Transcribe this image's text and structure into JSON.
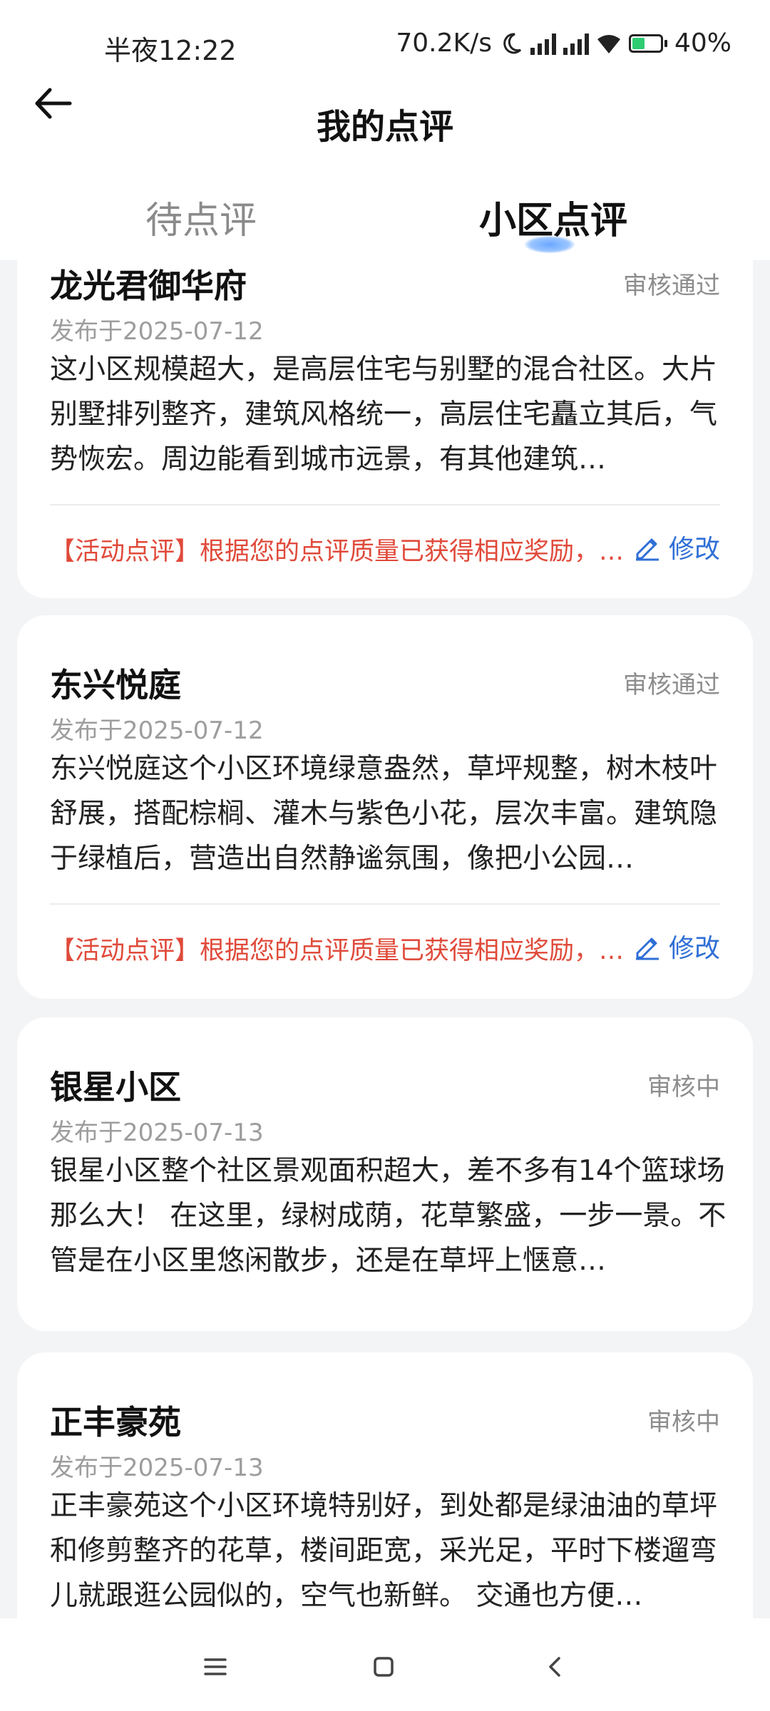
{
  "status_bar": {
    "time": "半夜12:22",
    "speed": "70.2K/s",
    "battery": "40%",
    "battery_level": 0.4,
    "icons": [
      "moon-icon",
      "signal-hd-icon",
      "signal-hd-icon",
      "wifi-icon",
      "battery-icon"
    ]
  },
  "header": {
    "title": "我的点评"
  },
  "tabs": [
    {
      "label": "待点评",
      "active": false
    },
    {
      "label": "小区点评",
      "active": true
    }
  ],
  "reviews": [
    {
      "name": "龙光君御华府",
      "status": "审核通过",
      "date": "发布于2025-07-12",
      "text": "这小区规模超大，是高层住宅与别墅的混合社区。大片别墅排列整齐，建筑风格统一，高层住宅矗立其后，气势恢宏。周边能看到城市远景，有其他建筑…",
      "note": "【活动点评】根据您的点评质量已获得相应奖励，…",
      "edit_label": "修改"
    },
    {
      "name": "东兴悦庭",
      "status": "审核通过",
      "date": "发布于2025-07-12",
      "text": "东兴悦庭这个小区环境绿意盎然，草坪规整，树木枝叶舒展，搭配棕榈、灌木与紫色小花，层次丰富。建筑隐于绿植后，营造出自然静谧氛围，像把小公园…",
      "note": "【活动点评】根据您的点评质量已获得相应奖励，…",
      "edit_label": "修改"
    },
    {
      "name": "银星小区",
      "status": "审核中",
      "date": "发布于2025-07-13",
      "text": "银星小区整个社区景观面积超大，差不多有14个篮球场那么大！ 在这里，绿树成荫，花草繁盛，一步一景。不管是在小区里悠闲散步，还是在草坪上惬意…"
    },
    {
      "name": "正丰豪苑",
      "status": "审核中",
      "date": "发布于2025-07-13",
      "text": "正丰豪苑这个小区环境特别好，到处都是绿油油的草坪和修剪整齐的花草，楼间距宽，采光足，平时下楼遛弯儿就跟逛公园似的，空气也新鲜。 交通也方便…"
    }
  ],
  "nav": {
    "icons": [
      "menu-icon",
      "home-icon",
      "back-nav-icon"
    ]
  }
}
